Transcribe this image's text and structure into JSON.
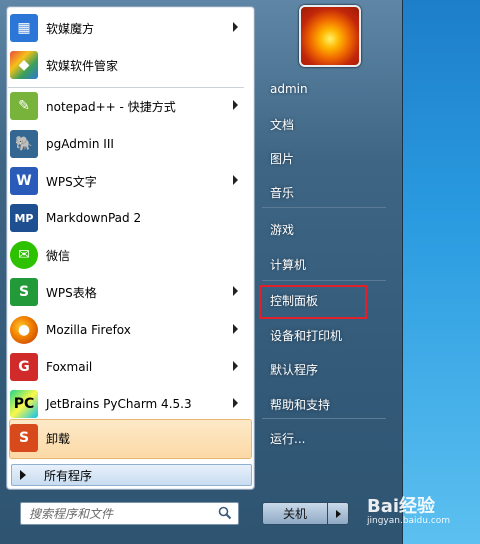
{
  "left_programs": [
    {
      "label": "软媒魔方",
      "icon": "rubik-cube-icon",
      "color": "#2b76d6",
      "arrow": true
    },
    {
      "label": "软媒软件管家",
      "icon": "software-manager-icon",
      "color": "#3aa05a",
      "arrow": false
    },
    {
      "label": "notepad++ - 快捷方式",
      "icon": "notepad-plus-icon",
      "color": "#78b43c",
      "arrow": true
    },
    {
      "label": "pgAdmin III",
      "icon": "elephant-icon",
      "color": "#336791",
      "arrow": false
    },
    {
      "label": "WPS文字",
      "icon": "wps-writer-icon",
      "color": "#2a5bb8",
      "arrow": true
    },
    {
      "label": "MarkdownPad 2",
      "icon": "markdownpad-icon",
      "color": "#1d4f91",
      "arrow": false
    },
    {
      "label": "微信",
      "icon": "wechat-icon",
      "color": "#2dc100",
      "arrow": false
    },
    {
      "label": "WPS表格",
      "icon": "wps-spreadsheet-icon",
      "color": "#229a3a",
      "arrow": true
    },
    {
      "label": "Mozilla Firefox",
      "icon": "firefox-icon",
      "color": "#e66000",
      "arrow": true
    },
    {
      "label": "Foxmail",
      "icon": "foxmail-icon",
      "color": "#d02a2a",
      "arrow": true
    },
    {
      "label": "JetBrains PyCharm 4.5.3",
      "icon": "pycharm-icon",
      "color": "#2aa86a",
      "arrow": true
    },
    {
      "label": "卸载",
      "icon": "uninstall-icon",
      "color": "#d84a1b",
      "arrow": false
    }
  ],
  "all_programs": "所有程序",
  "search": {
    "placeholder": "搜索程序和文件"
  },
  "right_items": [
    {
      "label": "admin"
    },
    {
      "label": "文档"
    },
    {
      "label": "图片"
    },
    {
      "label": "音乐"
    },
    {
      "label": "游戏"
    },
    {
      "label": "计算机"
    },
    {
      "label": "控制面板"
    },
    {
      "label": "设备和打印机"
    },
    {
      "label": "默认程序"
    },
    {
      "label": "帮助和支持"
    },
    {
      "label": "运行..."
    }
  ],
  "shutdown_label": "关机",
  "watermark": {
    "brand": "Bai经验",
    "url": "jingyan.baidu.com"
  },
  "highlight_color": "#e0202a"
}
